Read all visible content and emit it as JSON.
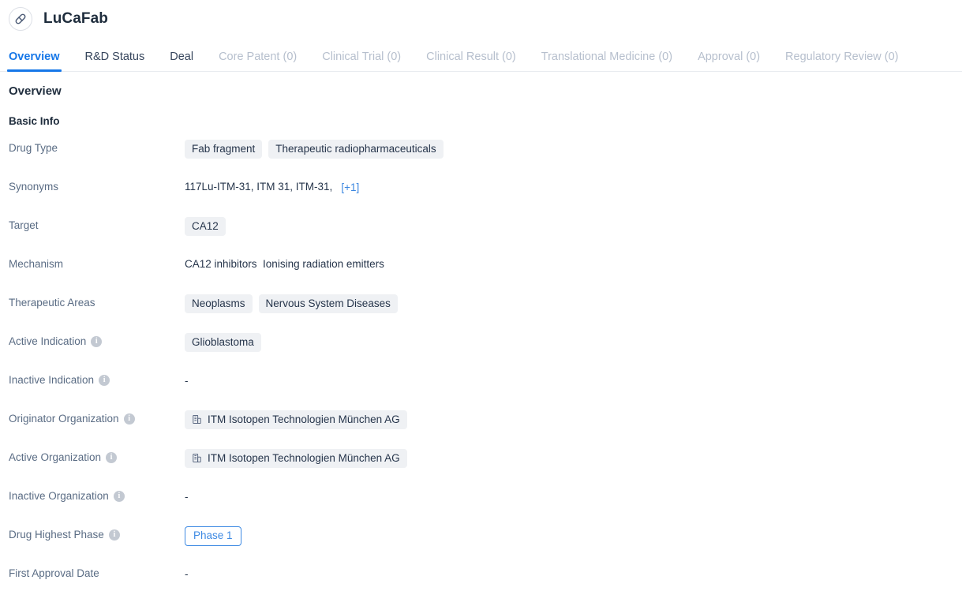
{
  "header": {
    "icon": "capsule-icon",
    "title": "LuCaFab"
  },
  "tabs": [
    {
      "label": "Overview",
      "state": "active"
    },
    {
      "label": "R&D Status",
      "state": "normal"
    },
    {
      "label": "Deal",
      "state": "normal"
    },
    {
      "label": "Core Patent (0)",
      "state": "disabled"
    },
    {
      "label": "Clinical Trial (0)",
      "state": "disabled"
    },
    {
      "label": "Clinical Result (0)",
      "state": "disabled"
    },
    {
      "label": "Translational Medicine (0)",
      "state": "disabled"
    },
    {
      "label": "Approval (0)",
      "state": "disabled"
    },
    {
      "label": "Regulatory Review (0)",
      "state": "disabled"
    }
  ],
  "overview": {
    "section_title": "Overview",
    "subsection_title": "Basic Info",
    "rows": {
      "drug_type": {
        "label": "Drug Type",
        "tags": [
          "Fab fragment",
          "Therapeutic radiopharmaceuticals"
        ]
      },
      "synonyms": {
        "label": "Synonyms",
        "values": "117Lu-ITM-31,  ITM 31,  ITM-31,",
        "more": "[+1]"
      },
      "target": {
        "label": "Target",
        "tags": [
          "CA12"
        ]
      },
      "mechanism": {
        "label": "Mechanism",
        "value": "CA12 inhibitors  Ionising radiation emitters"
      },
      "therapeutic_areas": {
        "label": "Therapeutic Areas",
        "tags": [
          "Neoplasms",
          "Nervous System Diseases"
        ]
      },
      "active_indication": {
        "label": "Active Indication",
        "info": "i",
        "tags": [
          "Glioblastoma"
        ]
      },
      "inactive_indication": {
        "label": "Inactive Indication",
        "info": "i",
        "value": "-"
      },
      "originator_organization": {
        "label": "Originator Organization",
        "info": "i",
        "org": "ITM Isotopen Technologien München AG"
      },
      "active_organization": {
        "label": "Active Organization",
        "info": "i",
        "org": "ITM Isotopen Technologien München AG"
      },
      "inactive_organization": {
        "label": "Inactive Organization",
        "info": "i",
        "value": "-"
      },
      "drug_highest_phase": {
        "label": "Drug Highest Phase",
        "info": "i",
        "badge": "Phase 1"
      },
      "first_approval_date": {
        "label": "First Approval Date",
        "value": "-"
      }
    }
  },
  "colors": {
    "accent": "#1677e8",
    "tag_bg": "#eff1f4",
    "label_text": "#5a6c84",
    "value_text": "#26354b",
    "disabled_tab": "#b6bfcd",
    "phase_border": "#3e8ae3"
  }
}
